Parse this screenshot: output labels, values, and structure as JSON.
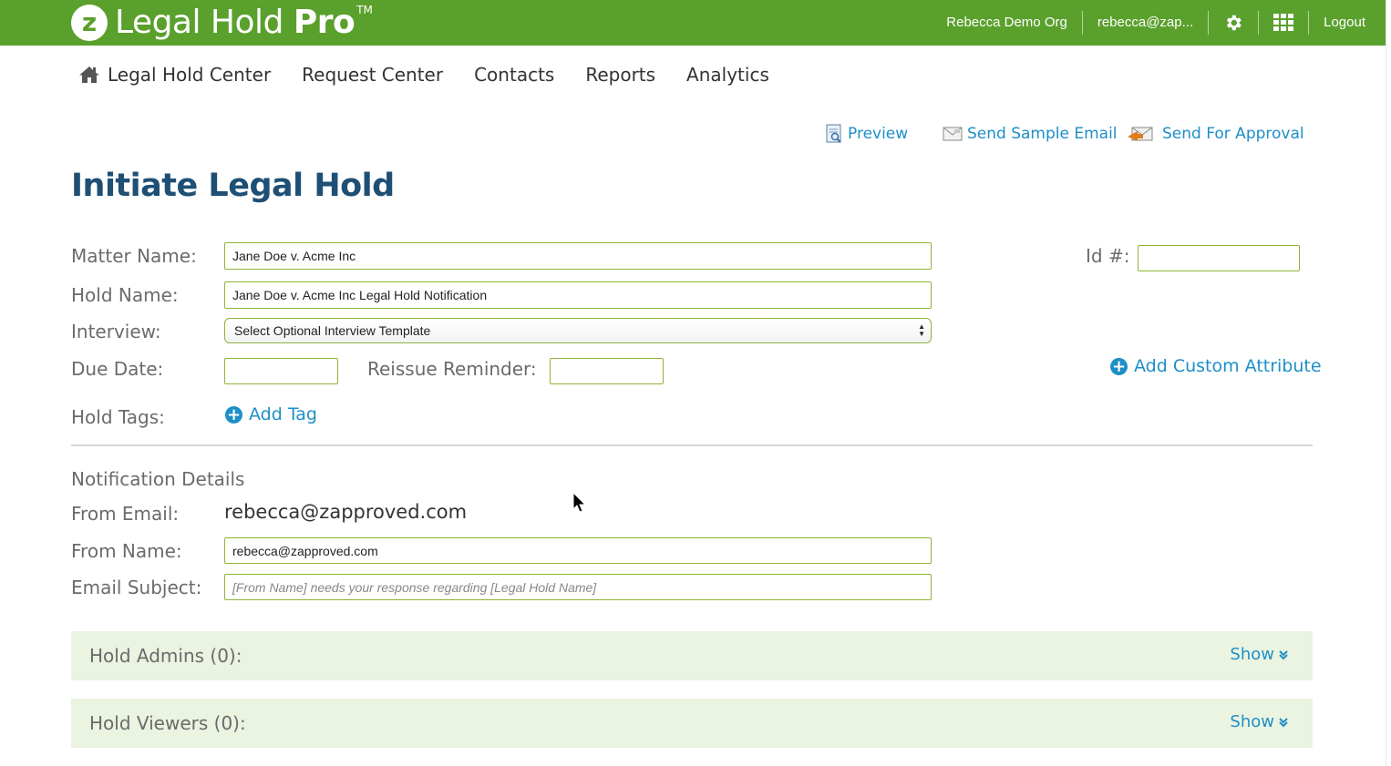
{
  "header": {
    "logo_letter": "z",
    "brand_light": "Legal Hold ",
    "brand_bold": "Pro",
    "brand_tm": "TM",
    "org_name": "Rebecca Demo Org",
    "user_email": "rebecca@zap...",
    "settings_icon": "gear-icon",
    "apps_icon": "grid-icon",
    "logout_label": "Logout",
    "brand_color": "#5aa02c"
  },
  "nav": {
    "home_icon": "home-icon",
    "items": [
      {
        "label": "Legal Hold Center"
      },
      {
        "label": "Request Center"
      },
      {
        "label": "Contacts"
      },
      {
        "label": "Reports"
      },
      {
        "label": "Analytics"
      }
    ]
  },
  "actions": {
    "preview_label": "Preview",
    "send_sample_label": "Send Sample Email",
    "send_approval_label": "Send For Approval",
    "link_color": "#1d8fc7"
  },
  "page": {
    "title": "Initiate Legal Hold",
    "title_color": "#1e4f75"
  },
  "form": {
    "matter_name_label": "Matter Name:",
    "matter_name_value": "Jane Doe v. Acme Inc",
    "id_label": "Id #:",
    "id_value": "",
    "hold_name_label": "Hold Name:",
    "hold_name_value": "Jane Doe v. Acme Inc Legal Hold Notification",
    "interview_label": "Interview:",
    "interview_selected": "Select Optional Interview Template",
    "due_date_label": "Due Date:",
    "due_date_value": "",
    "reissue_label": "Reissue Reminder:",
    "reissue_value": "",
    "add_custom_attribute_label": "Add Custom Attribute",
    "hold_tags_label": "Hold Tags:",
    "add_tag_label": "Add Tag",
    "field_border_color": "#8fb33a"
  },
  "notification": {
    "section_title": "Notification Details",
    "from_email_label": "From Email:",
    "from_email_value": "rebecca@zapproved.com",
    "from_name_label": "From Name:",
    "from_name_value": "rebecca@zapproved.com",
    "email_subject_label": "Email Subject:",
    "email_subject_placeholder": "[From Name] needs your response regarding [Legal Hold Name]"
  },
  "panels": [
    {
      "title": "Hold Admins (0):",
      "toggle_label": "Show"
    },
    {
      "title": "Hold Viewers (0):",
      "toggle_label": "Show"
    }
  ]
}
